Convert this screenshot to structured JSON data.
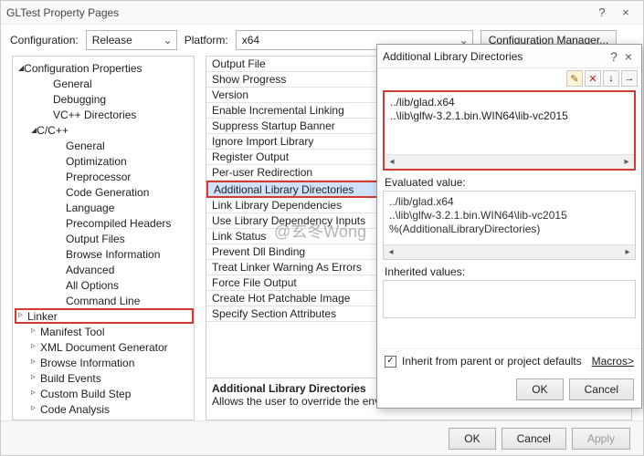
{
  "window": {
    "title": "GLTest Property Pages",
    "help": "?",
    "close": "×"
  },
  "configRow": {
    "label1": "Configuration:",
    "value1": "Release",
    "label2": "Platform:",
    "value2": "x64",
    "button": "Configuration Manager..."
  },
  "tree": {
    "root": "Configuration Properties",
    "items": [
      "General",
      "Debugging",
      "VC++ Directories"
    ],
    "ccpp": "C/C++",
    "ccpp_items": [
      "General",
      "Optimization",
      "Preprocessor",
      "Code Generation",
      "Language",
      "Precompiled Headers",
      "Output Files",
      "Browse Information",
      "Advanced",
      "All Options",
      "Command Line"
    ],
    "linker": "Linker",
    "rest": [
      "Manifest Tool",
      "XML Document Generator",
      "Browse Information",
      "Build Events",
      "Custom Build Step",
      "Code Analysis"
    ]
  },
  "propList": [
    "Output File",
    "Show Progress",
    "Version",
    "Enable Incremental Linking",
    "Suppress Startup Banner",
    "Ignore Import Library",
    "Register Output",
    "Per-user Redirection",
    "Additional Library Directories",
    "Link Library Dependencies",
    "Use Library Dependency Inputs",
    "Link Status",
    "Prevent Dll Binding",
    "Treat Linker Warning As Errors",
    "Force File Output",
    "Create Hot Patchable Image",
    "Specify Section Attributes"
  ],
  "propDesc": {
    "title": "Additional Library Directories",
    "body": "Allows the user to override the environmental lib"
  },
  "footer": {
    "ok": "OK",
    "cancel": "Cancel",
    "apply": "Apply"
  },
  "dialog": {
    "title": "Additional Library Directories",
    "help": "?",
    "lines": [
      "../lib/glad.x64",
      "..\\lib\\glfw-3.2.1.bin.WIN64\\lib-vc2015"
    ],
    "evalLabel": "Evaluated value:",
    "evalLines": [
      "../lib/glad.x64",
      "..\\lib\\glfw-3.2.1.bin.WIN64\\lib-vc2015",
      "%(AdditionalLibraryDirectories)"
    ],
    "inhLabel": "Inherited values:",
    "inheritChk": "Inherit from parent or project defaults",
    "macros": "Macros>",
    "ok": "OK",
    "cancel": "Cancel"
  },
  "watermark": "@玄冬Wong"
}
